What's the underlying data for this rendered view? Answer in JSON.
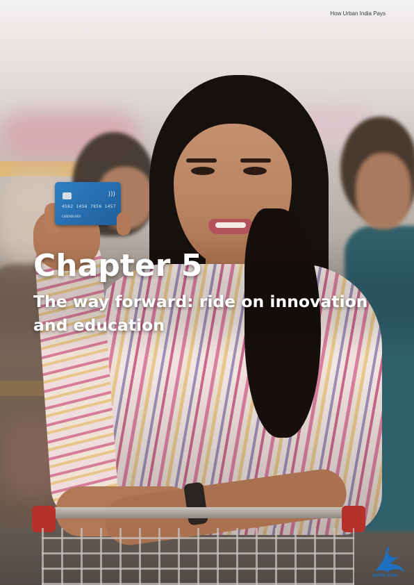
{
  "header": {
    "running_title": "How Urban India Pays"
  },
  "chapter": {
    "title": "Chapter 5",
    "subtitle_line1": "The way forward: ride on innovation",
    "subtitle_line2": "and education"
  },
  "photo": {
    "card": {
      "number": "4562 1456 7856 1457",
      "holder": "CARDHOLDER"
    }
  },
  "watermark": {
    "text": "ЖИВИ.КОМ",
    "color": "#1f6fc0"
  },
  "colors": {
    "title_text": "#ffffff",
    "header_text": "#3c3c3c",
    "card": "#2f7fc2"
  }
}
